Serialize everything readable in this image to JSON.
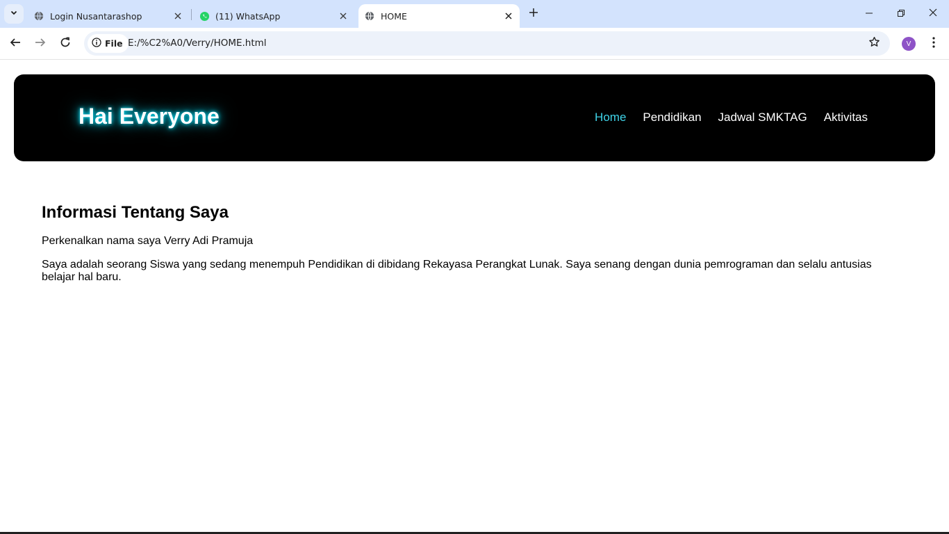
{
  "browser": {
    "tabs": [
      {
        "title": "Login Nusantarashop",
        "icon": "globe-icon",
        "active": false
      },
      {
        "title": "(11) WhatsApp",
        "icon": "whatsapp-icon",
        "active": false
      },
      {
        "title": "HOME",
        "icon": "globe-icon",
        "active": true
      }
    ],
    "site_info_label": "File",
    "url": "E:/%C2%A0/Verry/HOME.html",
    "profile_initial": "V",
    "colors": {
      "tabstrip": "#d3e3fd",
      "omnibox": "#edf2fa",
      "profile": "#8e53c7"
    }
  },
  "page": {
    "header": {
      "brand": "Hai Everyone",
      "nav": [
        {
          "label": "Home",
          "active": true
        },
        {
          "label": "Pendidikan",
          "active": false
        },
        {
          "label": "Jadwal SMKTAG",
          "active": false
        },
        {
          "label": "Aktivitas",
          "active": false
        }
      ],
      "colors": {
        "background": "#000000",
        "glow": "#00e5ff",
        "active_link": "#3fd3e8"
      }
    },
    "main": {
      "heading": "Informasi Tentang Saya",
      "paragraphs": [
        "Perkenalkan nama saya Verry Adi Pramuja",
        "Saya adalah seorang Siswa yang sedang menempuh Pendidikan di dibidang Rekayasa Perangkat Lunak. Saya senang dengan dunia pemrograman dan selalu antusias belajar hal baru."
      ]
    }
  }
}
